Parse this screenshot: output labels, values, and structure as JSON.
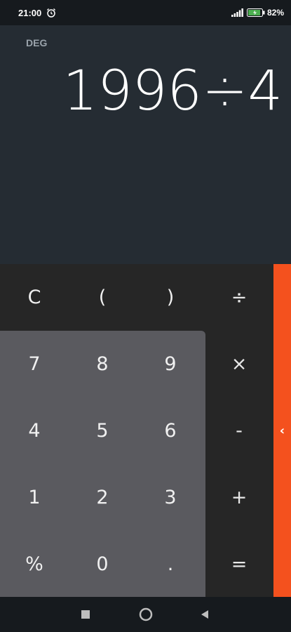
{
  "status_bar": {
    "time": "21:00",
    "battery": "82%"
  },
  "display": {
    "angle_mode": "DEG",
    "expression": "1996÷4"
  },
  "keys": {
    "clear": "C",
    "open_paren": "(",
    "close_paren": ")",
    "divide": "÷",
    "seven": "7",
    "eight": "8",
    "nine": "9",
    "multiply": "×",
    "four": "4",
    "five": "5",
    "six": "6",
    "minus": "-",
    "one": "1",
    "two": "2",
    "three": "3",
    "plus": "+",
    "percent": "%",
    "zero": "0",
    "decimal": ".",
    "equals": "="
  },
  "side_panel": {
    "arrow": "‹",
    "icon": "chevron-left-icon"
  },
  "nav_bar": {
    "icons": [
      "square-recents-icon",
      "circle-home-icon",
      "triangle-back-icon"
    ]
  },
  "colors": {
    "display_bg": "#252c33",
    "keypad_bg": "#262626",
    "number_panel_bg": "#5a5a5f",
    "accent": "#f4511e"
  }
}
